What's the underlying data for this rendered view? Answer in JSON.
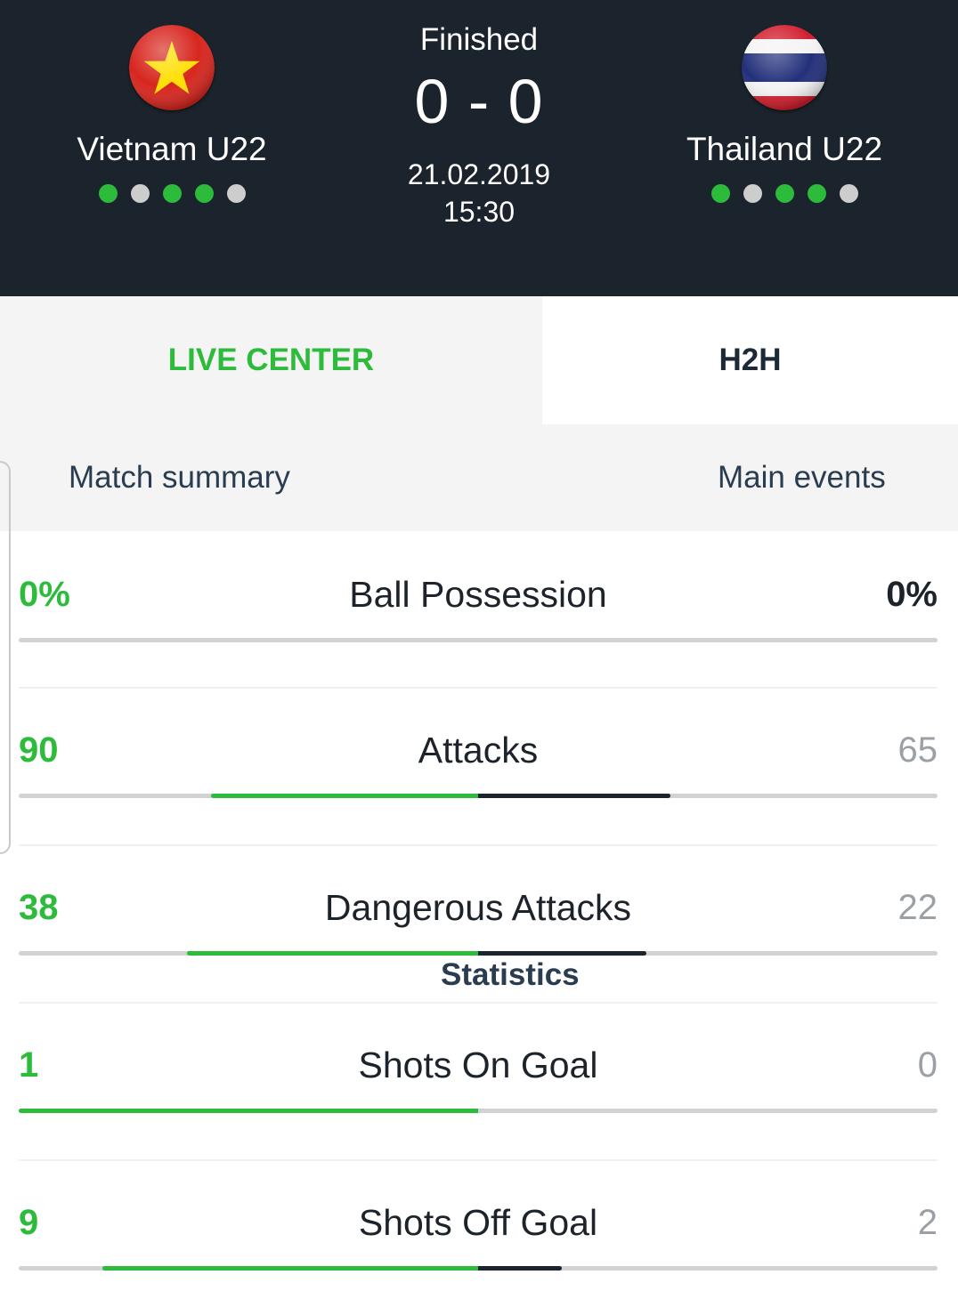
{
  "match": {
    "status": "Finished",
    "score": "0 - 0",
    "date": "21.02.2019",
    "time": "15:30"
  },
  "home": {
    "name": "Vietnam U22",
    "flag_icon": "vietnam-flag-icon",
    "form": [
      "win",
      "draw",
      "win",
      "win",
      "draw"
    ]
  },
  "away": {
    "name": "Thailand U22",
    "flag_icon": "thailand-flag-icon",
    "form": [
      "win",
      "draw",
      "win",
      "win",
      "draw"
    ]
  },
  "main_tabs": {
    "live_center": "LIVE CENTER",
    "h2h": "H2H",
    "active": "live_center"
  },
  "sub_tabs": {
    "summary": "Match summary",
    "statistics": "Statistics",
    "events": "Main events",
    "active": "statistics"
  },
  "stats": [
    {
      "label": "Ball Possession",
      "home": "0%",
      "away": "0%",
      "home_value": 0,
      "away_value": 0
    },
    {
      "label": "Attacks",
      "home": "90",
      "away": "65",
      "home_value": 90,
      "away_value": 65
    },
    {
      "label": "Dangerous Attacks",
      "home": "38",
      "away": "22",
      "home_value": 38,
      "away_value": 22
    },
    {
      "label": "Shots On Goal",
      "home": "1",
      "away": "0",
      "home_value": 1,
      "away_value": 0
    },
    {
      "label": "Shots Off Goal",
      "home": "9",
      "away": "2",
      "home_value": 9,
      "away_value": 2
    }
  ],
  "colors": {
    "header_bg": "#1b242c",
    "accent_green": "#2dbb3b",
    "form_draw": "#cdcdcd",
    "away_bar": "#1b242c",
    "bar_track": "#d2d2d2"
  }
}
